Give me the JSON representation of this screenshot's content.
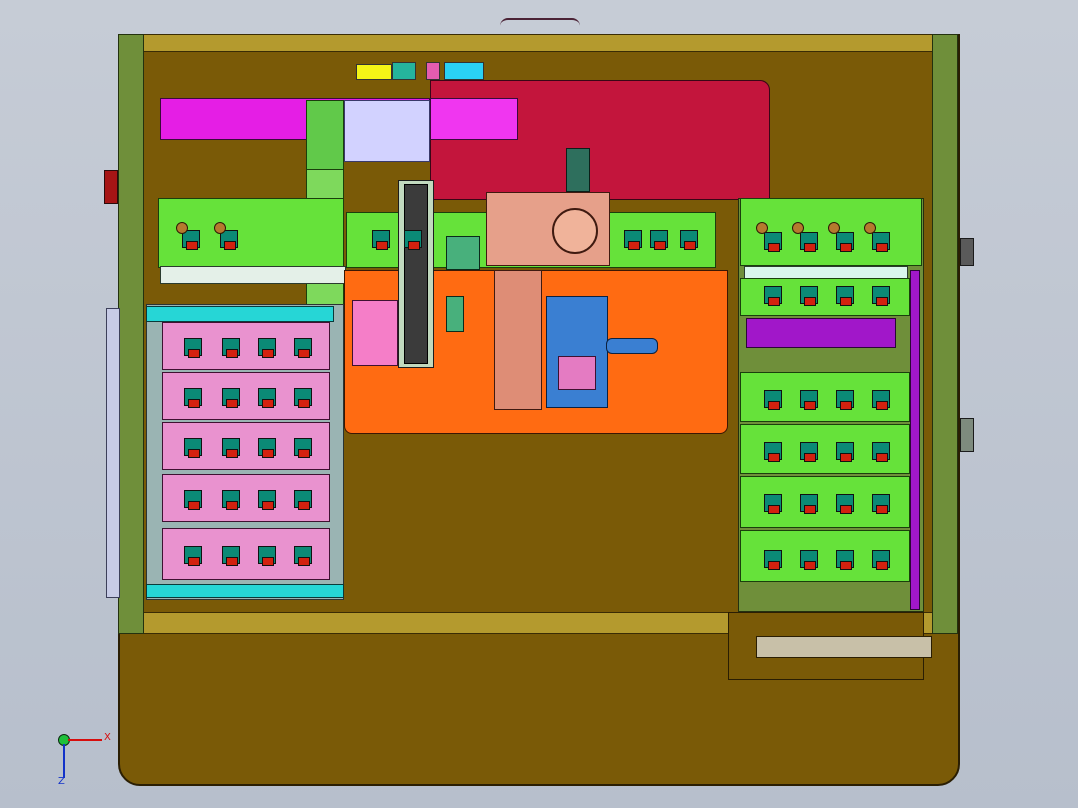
{
  "canvas": {
    "background": "#c0c7d2",
    "colors": {
      "base_plate": "#7a5a07",
      "frame_rail": "#b49a2e",
      "frame_post": "#6f8f3a",
      "tray_green": "#66e23a",
      "tray_pink": "#e992cf",
      "orange_plate": "#ff6b12",
      "crimson_plate": "#c3153c",
      "magenta_actuator": "#e51ee5",
      "purple_bar": "#a117c9",
      "cyan_bar": "#26d6d6",
      "motor_copper": "#de8d76",
      "blue_unit": "#3a7fd2"
    }
  },
  "model": {
    "left_tray_stack": {
      "tray_count": 5,
      "slots_per_tray": 4
    },
    "right_tray_stack": {
      "tray_count": 6,
      "slots_per_tray": 4
    },
    "top_tray_row": {
      "slots": 12
    }
  },
  "triad": {
    "x_label": "X",
    "z_label": "Z"
  }
}
